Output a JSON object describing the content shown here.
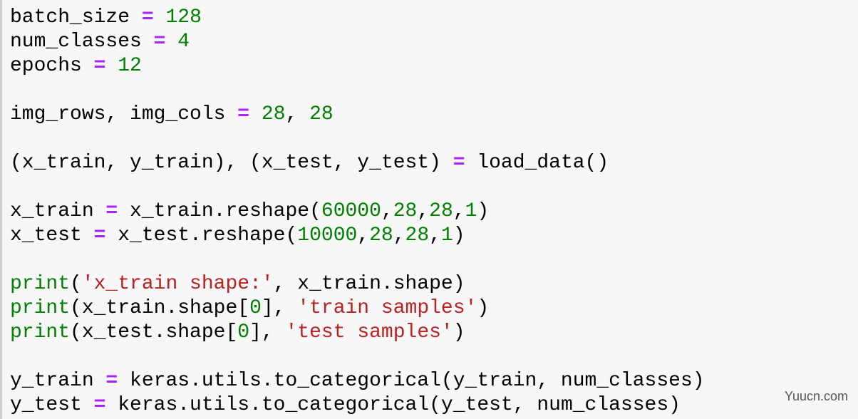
{
  "colors": {
    "background": "#f7f7f7",
    "border": "#cfcfcf",
    "operator": "#aa22ff",
    "number": "#008000",
    "builtin": "#008000",
    "string": "#ba2121",
    "text": "#000000"
  },
  "code_lines": [
    [
      {
        "t": "name",
        "v": "batch_size "
      },
      {
        "t": "op",
        "v": "="
      },
      {
        "t": "name",
        "v": " "
      },
      {
        "t": "num",
        "v": "128"
      }
    ],
    [
      {
        "t": "name",
        "v": "num_classes "
      },
      {
        "t": "op",
        "v": "="
      },
      {
        "t": "name",
        "v": " "
      },
      {
        "t": "num",
        "v": "4"
      }
    ],
    [
      {
        "t": "name",
        "v": "epochs "
      },
      {
        "t": "op",
        "v": "="
      },
      {
        "t": "name",
        "v": " "
      },
      {
        "t": "num",
        "v": "12"
      }
    ],
    [],
    [
      {
        "t": "name",
        "v": "img_rows, img_cols "
      },
      {
        "t": "op",
        "v": "="
      },
      {
        "t": "name",
        "v": " "
      },
      {
        "t": "num",
        "v": "28"
      },
      {
        "t": "name",
        "v": ", "
      },
      {
        "t": "num",
        "v": "28"
      }
    ],
    [],
    [
      {
        "t": "name",
        "v": "(x_train, y_train), (x_test, y_test) "
      },
      {
        "t": "op",
        "v": "="
      },
      {
        "t": "name",
        "v": " load_data()"
      }
    ],
    [],
    [
      {
        "t": "name",
        "v": "x_train "
      },
      {
        "t": "op",
        "v": "="
      },
      {
        "t": "name",
        "v": " x_train.reshape("
      },
      {
        "t": "num",
        "v": "60000"
      },
      {
        "t": "name",
        "v": ","
      },
      {
        "t": "num",
        "v": "28"
      },
      {
        "t": "name",
        "v": ","
      },
      {
        "t": "num",
        "v": "28"
      },
      {
        "t": "name",
        "v": ","
      },
      {
        "t": "num",
        "v": "1"
      },
      {
        "t": "name",
        "v": ")"
      }
    ],
    [
      {
        "t": "name",
        "v": "x_test "
      },
      {
        "t": "op",
        "v": "="
      },
      {
        "t": "name",
        "v": " x_test.reshape("
      },
      {
        "t": "num",
        "v": "10000"
      },
      {
        "t": "name",
        "v": ","
      },
      {
        "t": "num",
        "v": "28"
      },
      {
        "t": "name",
        "v": ","
      },
      {
        "t": "num",
        "v": "28"
      },
      {
        "t": "name",
        "v": ","
      },
      {
        "t": "num",
        "v": "1"
      },
      {
        "t": "name",
        "v": ")"
      }
    ],
    [],
    [
      {
        "t": "builtin",
        "v": "print"
      },
      {
        "t": "name",
        "v": "("
      },
      {
        "t": "str",
        "v": "'x_train shape:'"
      },
      {
        "t": "name",
        "v": ", x_train.shape)"
      }
    ],
    [
      {
        "t": "builtin",
        "v": "print"
      },
      {
        "t": "name",
        "v": "(x_train.shape["
      },
      {
        "t": "num",
        "v": "0"
      },
      {
        "t": "name",
        "v": "], "
      },
      {
        "t": "str",
        "v": "'train samples'"
      },
      {
        "t": "name",
        "v": ")"
      }
    ],
    [
      {
        "t": "builtin",
        "v": "print"
      },
      {
        "t": "name",
        "v": "(x_test.shape["
      },
      {
        "t": "num",
        "v": "0"
      },
      {
        "t": "name",
        "v": "], "
      },
      {
        "t": "str",
        "v": "'test samples'"
      },
      {
        "t": "name",
        "v": ")"
      }
    ],
    [],
    [
      {
        "t": "name",
        "v": "y_train "
      },
      {
        "t": "op",
        "v": "="
      },
      {
        "t": "name",
        "v": " keras.utils.to_categorical(y_train, num_classes)"
      }
    ],
    [
      {
        "t": "name",
        "v": "y_test "
      },
      {
        "t": "op",
        "v": "="
      },
      {
        "t": "name",
        "v": " keras.utils.to_categorical(y_test, num_classes)"
      }
    ]
  ],
  "watermark": "Yuucn.com"
}
